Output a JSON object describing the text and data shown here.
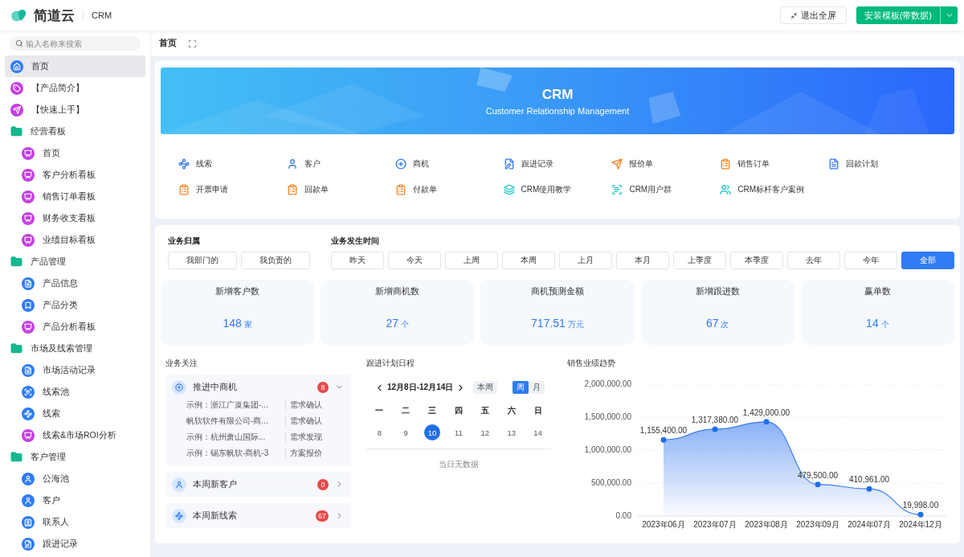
{
  "header": {
    "logo": "简道云",
    "app_name": "CRM",
    "exit_button": "退出全屏",
    "install_button": "安装模板(带数据)"
  },
  "sidebar": {
    "search_placeholder": "输入名称来搜索",
    "items": [
      {
        "label": "首页",
        "kind": "home",
        "color": "#2f7cf6",
        "selected": true
      },
      {
        "label": "【产品简介】",
        "kind": "tag",
        "color": "#c43fe0",
        "selected": false
      },
      {
        "label": "【快速上手】",
        "kind": "send",
        "color": "#c43fe0",
        "selected": false
      },
      {
        "label": "经营看板",
        "kind": "folder",
        "color": "#14b88f",
        "selected": false,
        "children": [
          {
            "label": "首页",
            "kind": "dashboard",
            "color": "#c43fe0",
            "selected": false
          },
          {
            "label": "客户分析看板",
            "kind": "dashboard",
            "color": "#c43fe0",
            "selected": false
          },
          {
            "label": "销售订单看板",
            "kind": "dashboard",
            "color": "#c43fe0",
            "selected": false
          },
          {
            "label": "财务收支看板",
            "kind": "dashboard",
            "color": "#c43fe0",
            "selected": false
          },
          {
            "label": "业绩目标看板",
            "kind": "dashboard",
            "color": "#c43fe0",
            "selected": false
          }
        ]
      },
      {
        "label": "产品管理",
        "kind": "folder",
        "color": "#14b88f",
        "selected": false,
        "children": [
          {
            "label": "产品信息",
            "kind": "form",
            "color": "#2f7cf6",
            "selected": false
          },
          {
            "label": "产品分类",
            "kind": "bookmark",
            "color": "#2f7cf6",
            "selected": false
          },
          {
            "label": "产品分析看板",
            "kind": "dashboard",
            "color": "#c43fe0",
            "selected": false
          }
        ]
      },
      {
        "label": "市场及线索管理",
        "kind": "folder",
        "color": "#14b88f",
        "selected": false,
        "children": [
          {
            "label": "市场活动记录",
            "kind": "form",
            "color": "#2f7cf6",
            "selected": false
          },
          {
            "label": "线索池",
            "kind": "pool",
            "color": "#2f7cf6",
            "selected": false
          },
          {
            "label": "线索",
            "kind": "lead",
            "color": "#2f7cf6",
            "selected": false
          },
          {
            "label": "线索&市场ROI分析",
            "kind": "dashboard",
            "color": "#c43fe0",
            "selected": false
          }
        ]
      },
      {
        "label": "客户管理",
        "kind": "folder",
        "color": "#14b88f",
        "selected": false,
        "children": [
          {
            "label": "公海池",
            "kind": "user",
            "color": "#2f7cf6",
            "selected": false
          },
          {
            "label": "客户",
            "kind": "user",
            "color": "#2f7cf6",
            "selected": false
          },
          {
            "label": "联系人",
            "kind": "contact",
            "color": "#2f7cf6",
            "selected": false
          },
          {
            "label": "跟进记录",
            "kind": "record",
            "color": "#2f7cf6",
            "selected": false
          }
        ]
      }
    ]
  },
  "breadcrumb": {
    "title": "首页"
  },
  "banner": {
    "title": "CRM",
    "subtitle": "Customer Relationship Management"
  },
  "shortcuts": [
    {
      "label": "线索",
      "kind": "lead",
      "color": "#3b7cf0"
    },
    {
      "label": "客户",
      "kind": "user",
      "color": "#3b7cf0"
    },
    {
      "label": "商机",
      "kind": "opportunity",
      "color": "#3b7cf0"
    },
    {
      "label": "跟进记录",
      "kind": "record",
      "color": "#3b7cf0"
    },
    {
      "label": "报价单",
      "kind": "send",
      "color": "#f7862a"
    },
    {
      "label": "销售订单",
      "kind": "clipboard",
      "color": "#f7862a"
    },
    {
      "label": "回款计划",
      "kind": "form",
      "color": "#3b7cf0"
    },
    {
      "label": "开票申请",
      "kind": "clipboard",
      "color": "#f7862a"
    },
    {
      "label": "回款单",
      "kind": "clipboard",
      "color": "#f7862a"
    },
    {
      "label": "付款单",
      "kind": "clipboard",
      "color": "#f7862a"
    },
    {
      "label": "CRM使用教学",
      "kind": "layers",
      "color": "#2ec7c9"
    },
    {
      "label": "CRM用户群",
      "kind": "scan",
      "color": "#2ec7c9"
    },
    {
      "label": "CRM标杆客户案例",
      "kind": "users",
      "color": "#2ec7c9"
    }
  ],
  "filters": {
    "owner_label": "业务归属",
    "owner_options": [
      {
        "label": "我部门的",
        "selected": false
      },
      {
        "label": "我负责的",
        "selected": false
      }
    ],
    "time_label": "业务发生时间",
    "time_options": [
      {
        "label": "昨天",
        "selected": false
      },
      {
        "label": "今天",
        "selected": false
      },
      {
        "label": "上周",
        "selected": false
      },
      {
        "label": "本周",
        "selected": false
      },
      {
        "label": "上月",
        "selected": false
      },
      {
        "label": "本月",
        "selected": false
      },
      {
        "label": "上季度",
        "selected": false
      },
      {
        "label": "本季度",
        "selected": false
      },
      {
        "label": "去年",
        "selected": false
      },
      {
        "label": "今年",
        "selected": false
      },
      {
        "label": "全部",
        "selected": true
      }
    ]
  },
  "stats": [
    {
      "label": "新增客户数",
      "value": "148",
      "unit": "家"
    },
    {
      "label": "新增商机数",
      "value": "27",
      "unit": "个"
    },
    {
      "label": "商机预测金额",
      "value": "717.51",
      "unit": "万元"
    },
    {
      "label": "新增跟进数",
      "value": "67",
      "unit": "次"
    },
    {
      "label": "赢单数",
      "value": "14",
      "unit": "个"
    }
  ],
  "focus": {
    "title": "业务关注",
    "groups": [
      {
        "title": "推进中商机",
        "kind": "opportunity",
        "count": "8",
        "expanded": true,
        "rows": [
          {
            "name": "示例：浙江广厦集团-...",
            "stage": "需求确认"
          },
          {
            "name": "帆软软件有限公司-商...",
            "stage": "需求确认"
          },
          {
            "name": "示例：杭州萧山国际...",
            "stage": "需求发现"
          },
          {
            "name": "示例：锡东帆软-商机-3",
            "stage": "方案报价"
          }
        ]
      },
      {
        "title": "本周新客户",
        "kind": "user",
        "count": "0",
        "expanded": false
      },
      {
        "title": "本周新线索",
        "kind": "lead",
        "count": "67",
        "expanded": false
      }
    ]
  },
  "schedule": {
    "title": "跟进计划日程",
    "range": "12月8日-12月14日",
    "this_week": "本周",
    "views": [
      {
        "label": "周",
        "selected": true
      },
      {
        "label": "月",
        "selected": false
      }
    ],
    "weekdays": [
      "一",
      "二",
      "三",
      "四",
      "五",
      "六",
      "日"
    ],
    "days": [
      {
        "label": "8",
        "selected": false
      },
      {
        "label": "9",
        "selected": false
      },
      {
        "label": "10",
        "selected": true
      },
      {
        "label": "11",
        "selected": false
      },
      {
        "label": "12",
        "selected": false
      },
      {
        "label": "13",
        "selected": false
      },
      {
        "label": "14",
        "selected": false
      }
    ],
    "empty": "当日无数据"
  },
  "sales_trend": {
    "title": "销售业绩趋势",
    "chart_data": {
      "type": "area",
      "categories": [
        "2023年06月",
        "2023年07月",
        "2023年08月",
        "2023年09月",
        "2024年07月",
        "2024年12月"
      ],
      "series": [
        {
          "color": "#3b7cf0",
          "values": [
            1155400,
            1317380,
            1429000,
            479500,
            410961,
            19998
          ]
        }
      ],
      "ylim": [
        0,
        2000000
      ],
      "yticks": [
        {
          "value": 0,
          "label": "0.00"
        },
        {
          "value": 500000,
          "label": "500,000.00"
        },
        {
          "value": 1000000,
          "label": "1,000,000.00"
        },
        {
          "value": 1500000,
          "label": "1,500,000.00"
        },
        {
          "value": 2000000,
          "label": "2,000,000.00"
        }
      ],
      "grid": true,
      "value_labels": [
        "1,155,400.00",
        "1,317,380.00",
        "1,429,000.00",
        "479,500.00",
        "410,961.00",
        "19,998.00"
      ]
    }
  }
}
